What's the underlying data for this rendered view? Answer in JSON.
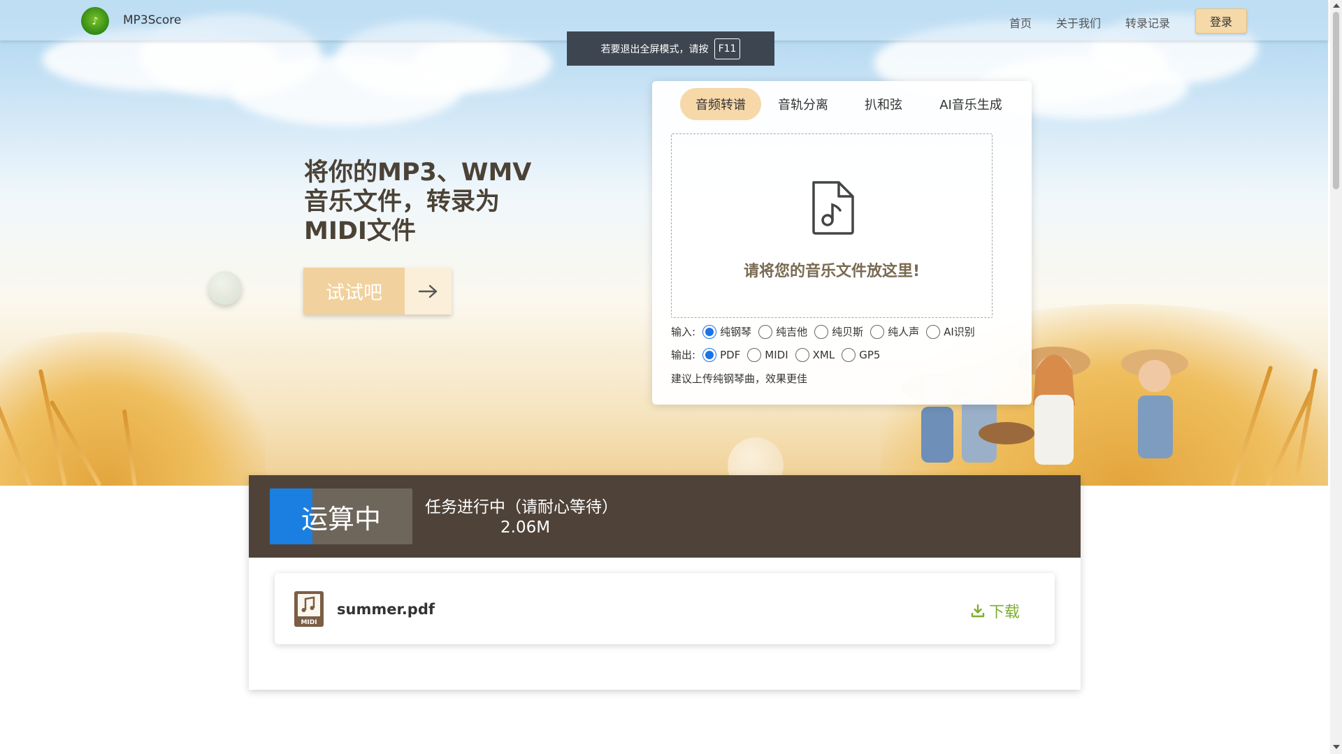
{
  "header": {
    "brand": "MP3Score",
    "nav": [
      "首页",
      "关于我们",
      "转录记录"
    ],
    "login": "登录"
  },
  "fullscreen_hint": {
    "text": "若要退出全屏模式，请按",
    "key": "F11"
  },
  "hero": {
    "title": "将你的MP3、WMV音乐文件，转录为MIDI文件",
    "try_button": "试试吧"
  },
  "upload": {
    "tabs": [
      "音频转谱",
      "音轨分离",
      "扒和弦",
      "AI音乐生成"
    ],
    "active_tab": "音频转谱",
    "drop_text": "请将您的音乐文件放这里!",
    "input_label": "输入:",
    "input_options": [
      "纯钢琴",
      "纯吉他",
      "纯贝斯",
      "纯人声",
      "AI识别"
    ],
    "input_selected": "纯钢琴",
    "output_label": "输出:",
    "output_options": [
      "PDF",
      "MIDI",
      "XML",
      "GP5"
    ],
    "output_selected": "PDF",
    "tip": "建议上传纯钢琴曲，效果更佳"
  },
  "task": {
    "status": "运算中",
    "progress": 0.3,
    "message": "任务进行中（请耐心等待）",
    "size": "2.06M"
  },
  "file": {
    "icon_label": "MIDI",
    "name": "summer.pdf",
    "download": "下载"
  },
  "colors": {
    "accent": "#f6d8a9",
    "status_bg": "#4f4339",
    "progress": "#1a7fe0",
    "download": "#7cae2c"
  }
}
